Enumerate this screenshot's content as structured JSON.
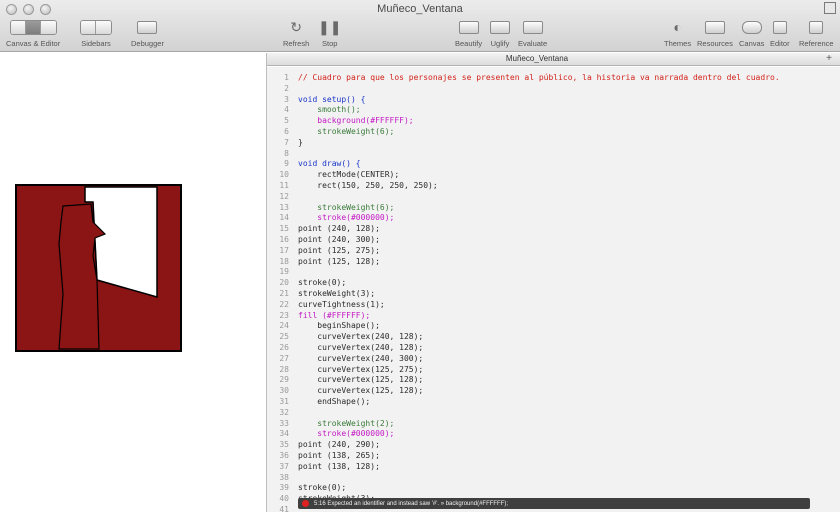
{
  "window": {
    "title": "Muñeco_Ventana"
  },
  "toolbar": {
    "canvas_editor": "Canvas & Editor",
    "sidebars": "Sidebars",
    "debugger": "Debugger",
    "refresh": "Refresh",
    "stop": "Stop",
    "beautify": "Beautify",
    "uglify": "Uglify",
    "evaluate": "Evaluate",
    "themes": "Themes",
    "resources": "Resources",
    "canvas": "Canvas",
    "editor": "Editor",
    "reference": "Reference"
  },
  "colors": {
    "sketch_fill": "#8b1414",
    "comment": "#d3221b",
    "keyword": "#1a35c8",
    "hex": "#c418c4"
  },
  "tab": {
    "label": "Muñeco_Ventana",
    "add": "+"
  },
  "code": [
    {
      "n": "1",
      "text": "// Cuadro para que los personajes se presenten al público, la historia va narrada dentro del cuadro.",
      "cls": "t-comment"
    },
    {
      "n": "2",
      "text": "",
      "cls": "t-plain"
    },
    {
      "n": "3",
      "text": "void setup() {",
      "cls": "t-kw"
    },
    {
      "n": "4",
      "text": "    smooth();",
      "cls": "t-fn"
    },
    {
      "n": "5",
      "text": "    background(#FFFFFF);",
      "cls": "t-str"
    },
    {
      "n": "6",
      "text": "    strokeWeight(6);",
      "cls": "t-fn"
    },
    {
      "n": "7",
      "text": "}",
      "cls": "t-plain"
    },
    {
      "n": "8",
      "text": "",
      "cls": "t-plain"
    },
    {
      "n": "9",
      "text": "void draw() {",
      "cls": "t-kw"
    },
    {
      "n": "10",
      "text": "    rectMode(CENTER);",
      "cls": "t-plain"
    },
    {
      "n": "11",
      "text": "    rect(150, 250, 250, 250);",
      "cls": "t-plain"
    },
    {
      "n": "12",
      "text": "",
      "cls": "t-plain"
    },
    {
      "n": "13",
      "text": "    strokeWeight(6);",
      "cls": "t-fn"
    },
    {
      "n": "14",
      "text": "    stroke(#000000);",
      "cls": "t-str"
    },
    {
      "n": "15",
      "text": "point (240, 128);",
      "cls": "t-plain"
    },
    {
      "n": "16",
      "text": "point (240, 300);",
      "cls": "t-plain"
    },
    {
      "n": "17",
      "text": "point (125, 275);",
      "cls": "t-plain"
    },
    {
      "n": "18",
      "text": "point (125, 128);",
      "cls": "t-plain"
    },
    {
      "n": "19",
      "text": "",
      "cls": "t-plain"
    },
    {
      "n": "20",
      "text": "stroke(0);",
      "cls": "t-plain"
    },
    {
      "n": "21",
      "text": "strokeWeight(3);",
      "cls": "t-plain"
    },
    {
      "n": "22",
      "text": "curveTightness(1);",
      "cls": "t-plain"
    },
    {
      "n": "23",
      "text": "fill (#FFFFFF);",
      "cls": "t-str"
    },
    {
      "n": "24",
      "text": "    beginShape();",
      "cls": "t-plain"
    },
    {
      "n": "25",
      "text": "    curveVertex(240, 128);",
      "cls": "t-plain"
    },
    {
      "n": "26",
      "text": "    curveVertex(240, 128);",
      "cls": "t-plain"
    },
    {
      "n": "27",
      "text": "    curveVertex(240, 300);",
      "cls": "t-plain"
    },
    {
      "n": "28",
      "text": "    curveVertex(125, 275);",
      "cls": "t-plain"
    },
    {
      "n": "29",
      "text": "    curveVertex(125, 128);",
      "cls": "t-plain"
    },
    {
      "n": "30",
      "text": "    curveVertex(125, 128);",
      "cls": "t-plain"
    },
    {
      "n": "31",
      "text": "    endShape();",
      "cls": "t-plain"
    },
    {
      "n": "32",
      "text": "",
      "cls": "t-plain"
    },
    {
      "n": "33",
      "text": "    strokeWeight(2);",
      "cls": "t-fn"
    },
    {
      "n": "34",
      "text": "    stroke(#000000);",
      "cls": "t-str"
    },
    {
      "n": "35",
      "text": "point (240, 290);",
      "cls": "t-plain"
    },
    {
      "n": "36",
      "text": "point (138, 265);",
      "cls": "t-plain"
    },
    {
      "n": "37",
      "text": "point (138, 128);",
      "cls": "t-plain"
    },
    {
      "n": "38",
      "text": "",
      "cls": "t-plain"
    },
    {
      "n": "39",
      "text": "stroke(0);",
      "cls": "t-plain"
    },
    {
      "n": "40",
      "text": "strokeWeight(3);",
      "cls": "t-plain"
    },
    {
      "n": "41",
      "text": "",
      "cls": "t-plain"
    }
  ],
  "error": {
    "message": "5:16 Expected an identifier and instead saw '#'. » background(#FFFFFF);"
  }
}
